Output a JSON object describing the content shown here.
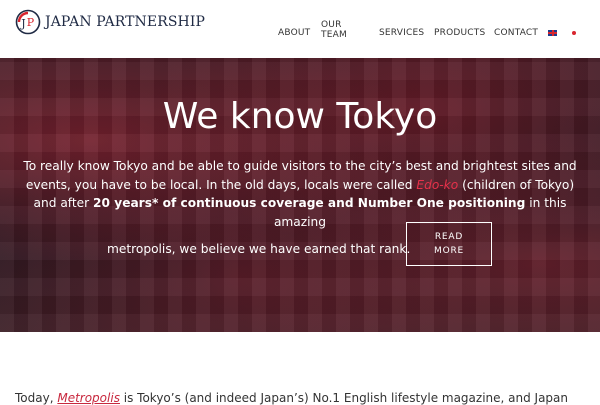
{
  "brand": {
    "name": "JAPAN PARTNERSHIP",
    "logo_letters": "JP",
    "colors": {
      "navy": "#1f2a44",
      "red": "#d8252e"
    }
  },
  "nav": {
    "items": [
      {
        "label": "ABOUT"
      },
      {
        "label": "OUR TEAM"
      },
      {
        "label": "SERVICES"
      },
      {
        "label": "PRODUCTS"
      },
      {
        "label": "CONTACT"
      }
    ],
    "languages": [
      {
        "icon": "uk-flag-icon"
      },
      {
        "icon": "japan-flag-icon"
      }
    ]
  },
  "hero": {
    "title": "We know Tokyo",
    "text_part1": "To really know Tokyo and be able to guide visitors to the city’s best and brightest sites and events, you have to be local. In the old days, locals were called ",
    "highlight": "Edo-ko",
    "text_part2": " (children of Tokyo) and after ",
    "bold": "20 years* of continuous coverage and Number One positioning",
    "text_part3": " in this amazing",
    "text_last": "metropolis, we believe we have earned that rank.",
    "button_line1": "READ",
    "button_line2": "MORE"
  },
  "body": {
    "intro": "Today, ",
    "link": "Metropolis",
    "rest": " is Tokyo’s (and indeed Japan’s) No.1 English lifestyle magazine, and Japan"
  }
}
